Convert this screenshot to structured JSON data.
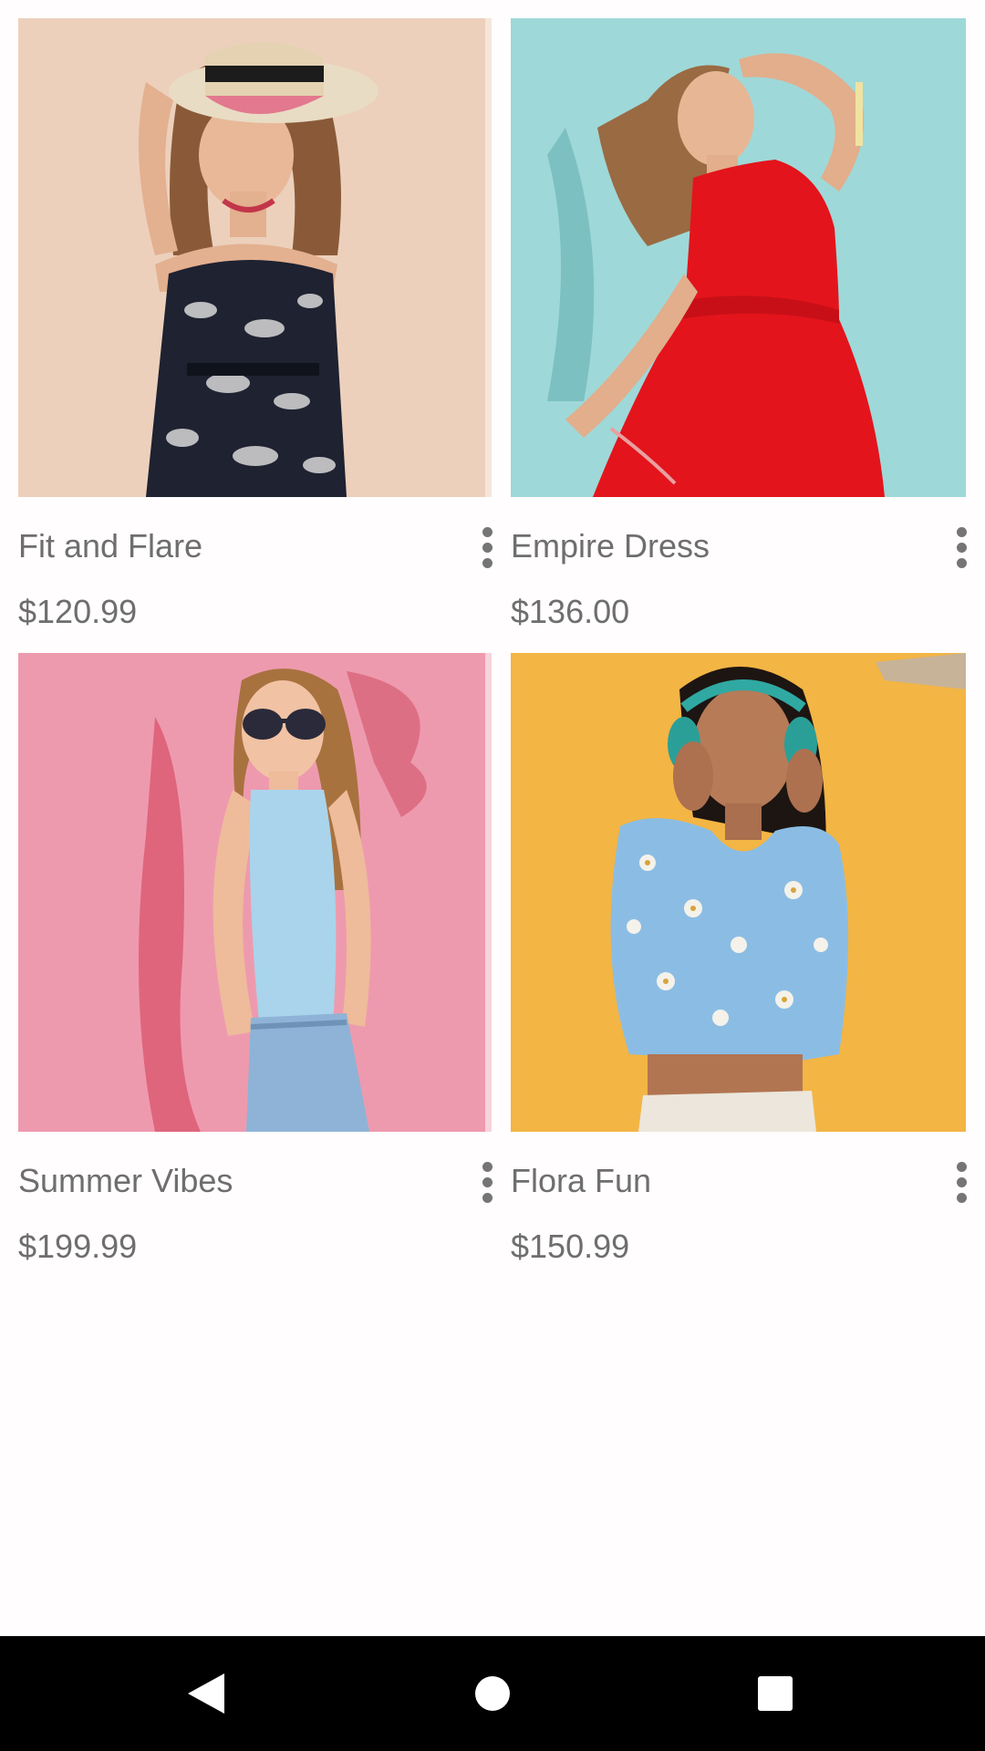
{
  "products": [
    {
      "name": "Fit and Flare",
      "price": "$120.99",
      "image_icon": "photo-woman-hat-floral-dress",
      "bg_color": "#ecd0bc"
    },
    {
      "name": "Empire Dress",
      "price": "$136.00",
      "image_icon": "photo-woman-red-dress",
      "bg_color": "#9fd8d8"
    },
    {
      "name": "Summer Vibes",
      "price": "$199.99",
      "image_icon": "photo-woman-sunglasses",
      "bg_color": "#ee9aae"
    },
    {
      "name": "Flora Fun",
      "price": "$150.99",
      "image_icon": "photo-woman-headphones",
      "bg_color": "#f3b544"
    }
  ],
  "navbar": {
    "back_icon": "back-triangle-icon",
    "home_icon": "home-circle-icon",
    "recents_icon": "recents-square-icon"
  }
}
